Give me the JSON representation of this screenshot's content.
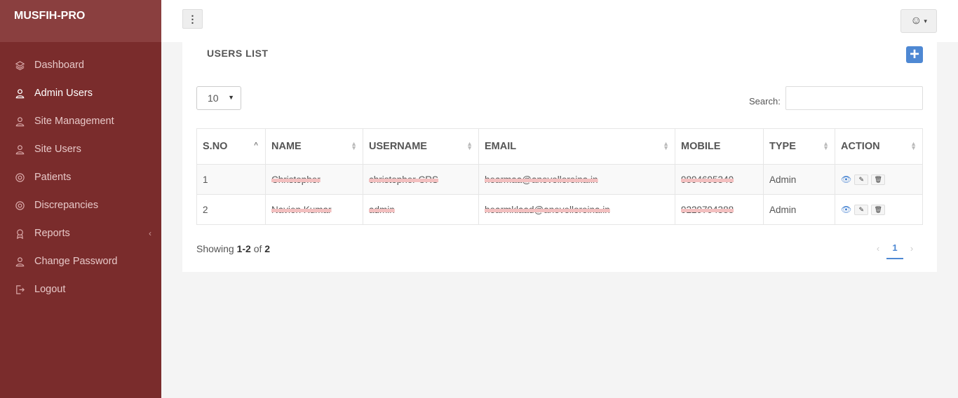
{
  "brand": "MUSFIH-PRO",
  "sidebar": {
    "items": [
      {
        "label": "Dashboard",
        "icon": "layers-icon"
      },
      {
        "label": "Admin Users",
        "icon": "user-icon"
      },
      {
        "label": "Site Management",
        "icon": "user-icon"
      },
      {
        "label": "Site Users",
        "icon": "user-icon"
      },
      {
        "label": "Patients",
        "icon": "lifebuoy-icon"
      },
      {
        "label": "Discrepancies",
        "icon": "lifebuoy-icon"
      },
      {
        "label": "Reports",
        "icon": "award-icon"
      },
      {
        "label": "Change Password",
        "icon": "user-icon"
      },
      {
        "label": "Logout",
        "icon": "logout-icon"
      }
    ]
  },
  "header": {
    "kebab": "⋮",
    "user_icon": "☺",
    "caret": "▾"
  },
  "card": {
    "title": "USERS LIST",
    "add": "+",
    "page_length": "10",
    "search_label": "Search:",
    "search_value": ""
  },
  "table": {
    "headers": [
      "S.NO",
      "NAME",
      "USERNAME",
      "EMAIL",
      "MOBILE",
      "TYPE",
      "ACTION"
    ],
    "rows": [
      {
        "sno": "1",
        "name": "Christopher",
        "username": "christopher CRS",
        "email": "hearmaa@anevelloreina.in",
        "mobile": "9894695340",
        "type": "Admin"
      },
      {
        "sno": "2",
        "name": "Navien Kumar",
        "username": "admin",
        "email": "hearmklaad@anevelloreina.in",
        "mobile": "9229794388",
        "type": "Admin"
      }
    ]
  },
  "footer": {
    "showing_prefix": "Showing ",
    "range": "1-2",
    "of": " of ",
    "total": "2",
    "page": "1",
    "prev": "‹",
    "next": "›"
  },
  "colors": {
    "sidebar": "#7a2c2c",
    "brand": "#8a3f3f",
    "accent": "#4e88d3"
  }
}
